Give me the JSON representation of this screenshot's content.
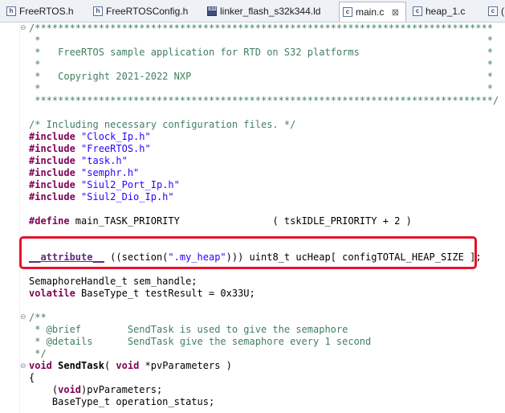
{
  "tabs": [
    {
      "label": "FreeRTOS.h",
      "icon": "h-file-icon",
      "icon_glyph": "h"
    },
    {
      "label": "FreeRTOSConfig.h",
      "icon": "h-file-icon",
      "icon_glyph": "h"
    },
    {
      "label": "linker_flash_s32k344.ld",
      "icon": "ld-file-icon",
      "icon_glyph": "S32"
    },
    {
      "label": "main.c",
      "icon": "c-file-icon",
      "icon_glyph": "c",
      "active": true,
      "close": "⊠"
    },
    {
      "label": "heap_1.c",
      "icon": "c-file-icon",
      "icon_glyph": "c"
    },
    {
      "label": "(",
      "icon": "c-file-icon",
      "icon_glyph": "c"
    }
  ],
  "code": {
    "l1": "/*******************************************************************************",
    "l2": " *                                                                             *",
    "l3": " *   FreeRTOS sample application for RTD on S32 platforms                      *",
    "l4": " *                                                                             *",
    "l5": " *   Copyright 2021-2022 NXP                                                   *",
    "l6": " *                                                                             *",
    "l7": " *******************************************************************************/",
    "l8": "/* Including necessary configuration files. */",
    "inc_kw": "#include",
    "inc1": "\"Clock_Ip.h\"",
    "inc2": "\"FreeRTOS.h\"",
    "inc3": "\"task.h\"",
    "inc4": "\"semphr.h\"",
    "inc5": "\"Siul2_Port_Ip.h\"",
    "inc6": "\"Siul2_Dio_Ip.h\"",
    "def_kw": "#define",
    "def_rest": " main_TASK_PRIORITY                ( tskIDLE_PRIORITY + 2 )",
    "attr": "__attribute__",
    "attr_mid1": " ((section(",
    "attr_str": "\".my_heap\"",
    "attr_mid2": "))) uint8_t ucHeap[ configTOTAL_HEAP_SIZE ];",
    "sem": "SemaphoreHandle_t sem_handle;",
    "vol_kw": "volatile",
    "vol_rest": " BaseType_t testResult = 0x33U;",
    "doc1": "/**",
    "doc2": " * @brief        SendTask is used to give the semaphore",
    "doc3": " * @details      SendTask give the semaphore every 1 second",
    "doc4": " */",
    "void_kw": "void",
    "fn_name": "SendTask",
    "fn_mid": "( ",
    "void_kw2": "void",
    "fn_rest": " *pvParameters )",
    "brace": "{",
    "body1_pre": "    (",
    "body1_kw": "void",
    "body1_rest": ")pvParameters;",
    "body2": "    BaseType_t operation_status;"
  },
  "fold_glyph": "⊖",
  "colors": {
    "highlight": "#e3122a",
    "keyword": "#7f0055",
    "string": "#2a00ff",
    "comment": "#3f7f5f"
  }
}
